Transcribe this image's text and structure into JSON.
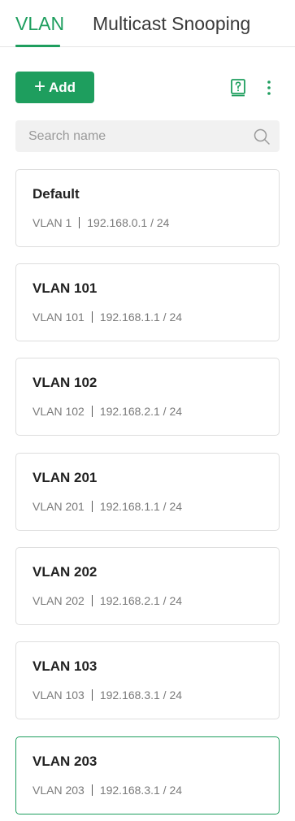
{
  "tabs": {
    "items": [
      {
        "label": "VLAN",
        "active": true
      },
      {
        "label": "Multicast Snooping",
        "active": false
      }
    ]
  },
  "toolbar": {
    "add_label": "Add",
    "add_icon": "plus-icon",
    "help_icon": "help-book-icon",
    "more_icon": "more-vertical-icon"
  },
  "search": {
    "placeholder": "Search name",
    "value": "",
    "icon": "search-icon"
  },
  "vlans": [
    {
      "name": "Default",
      "vlan": "VLAN 1",
      "ip": "192.168.0.1 / 24",
      "selected": false
    },
    {
      "name": "VLAN 101",
      "vlan": "VLAN 101",
      "ip": "192.168.1.1 / 24",
      "selected": false
    },
    {
      "name": "VLAN 102",
      "vlan": "VLAN 102",
      "ip": "192.168.2.1 / 24",
      "selected": false
    },
    {
      "name": "VLAN 201",
      "vlan": "VLAN 201",
      "ip": "192.168.1.1 / 24",
      "selected": false
    },
    {
      "name": "VLAN 202",
      "vlan": "VLAN 202",
      "ip": "192.168.2.1 / 24",
      "selected": false
    },
    {
      "name": "VLAN 103",
      "vlan": "VLAN 103",
      "ip": "192.168.3.1 / 24",
      "selected": false
    },
    {
      "name": "VLAN 203",
      "vlan": "VLAN 203",
      "ip": "192.168.3.1 / 24",
      "selected": true
    }
  ],
  "colors": {
    "accent": "#1e9e5e",
    "card_border": "#dedede",
    "search_bg": "#f1f1f1"
  }
}
